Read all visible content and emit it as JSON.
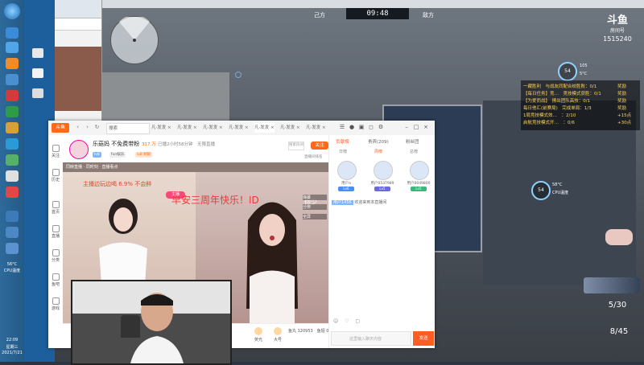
{
  "taskbar": {
    "time": "22:09",
    "weekday": "星期三",
    "date": "2021/7/21",
    "cpu_temp": "56°C",
    "cpu_label": "CPU温度"
  },
  "game": {
    "team_left": "己方",
    "team_right": "敌方",
    "timer": "09:48",
    "brand": "斗鱼",
    "brand_sub": "房间号",
    "room_number": "1515240",
    "gauge_value": "54",
    "gauge_side_1": "105",
    "gauge_side_2": "5°C",
    "quests": [
      {
        "left": "一藏胜利　与战友同配合绞胜败：0/1",
        "right": "奖励"
      },
      {
        "left": "【每日任务】竞…　竞技模式获胜：0/1",
        "right": "奖励"
      },
      {
        "left": "【为爱而战】　擦出团队高技：0/1",
        "right": "奖励"
      },
      {
        "left": "每日他汇(前赛局)　完成单局：1/3",
        "right": "奖励"
      },
      {
        "left": "1局竞技模式效…　：2/10",
        "right": "+15点"
      },
      {
        "left": "启航竞技模式开…　：0/6",
        "right": "+30点"
      }
    ],
    "gauge2_value": "54",
    "gauge2_temp": "58°C",
    "gauge2_label": "CPU温度",
    "ammo": "5/30",
    "hp": "8/45"
  },
  "browser": {
    "logo": "斗鱼",
    "search_placeholder": "搜索",
    "tabs": [
      "凡·发发 ×",
      "凡·发发 ×",
      "凡·发发 ×",
      "凡·发发 ×",
      "凡·发发 ×",
      "凡·发发 ×",
      "凡·发发 ×"
    ],
    "left_nav": [
      "关注",
      "历史",
      "首页",
      "直播",
      "分类",
      "鱼吧",
      "游戏"
    ],
    "anchor": {
      "name": "乐菇妈 不免费带粉",
      "hotness": "317.万",
      "meta": "已播2小时58分钟　无限直播",
      "tags": [
        "lv8",
        "fun娱乐",
        "lv8 刷屏"
      ],
      "search": "搜索房间",
      "follow": "关注",
      "rank": "直播间排名"
    },
    "video": {
      "topbar": "同映直播 · 同时刻 · 直播看点",
      "overlay_left": "主播边玩边喝 6.9% 不会醉",
      "pink_badge": "主播",
      "overlay_main": "早安三周年快乐！ID",
      "overlay_right": "你少",
      "ctrl": [
        "弹幕",
        "分辨",
        "全屏"
      ]
    },
    "gifts": [
      "荧光",
      "大号",
      "鱼丸",
      "飞机"
    ],
    "coins": "鱼丸 120953　鱼翅 0",
    "right_panel": {
      "tabs": [
        "贡献榜",
        "贵宾(209)",
        "粉丝团"
      ],
      "subtabs": [
        "日榜",
        "周榜",
        "总榜"
      ],
      "ranks": [
        {
          "name": "用户a",
          "badge": "Lv6"
        },
        {
          "name": "用户0537989",
          "badge": "Lv5"
        },
        {
          "name": "用户0049800",
          "badge": "Lv5"
        }
      ],
      "chat": "欢迎来到本直播间",
      "chat_user": "用户1456",
      "chat_input_placeholder": "这里输入聊天内容",
      "send": "发送"
    }
  }
}
